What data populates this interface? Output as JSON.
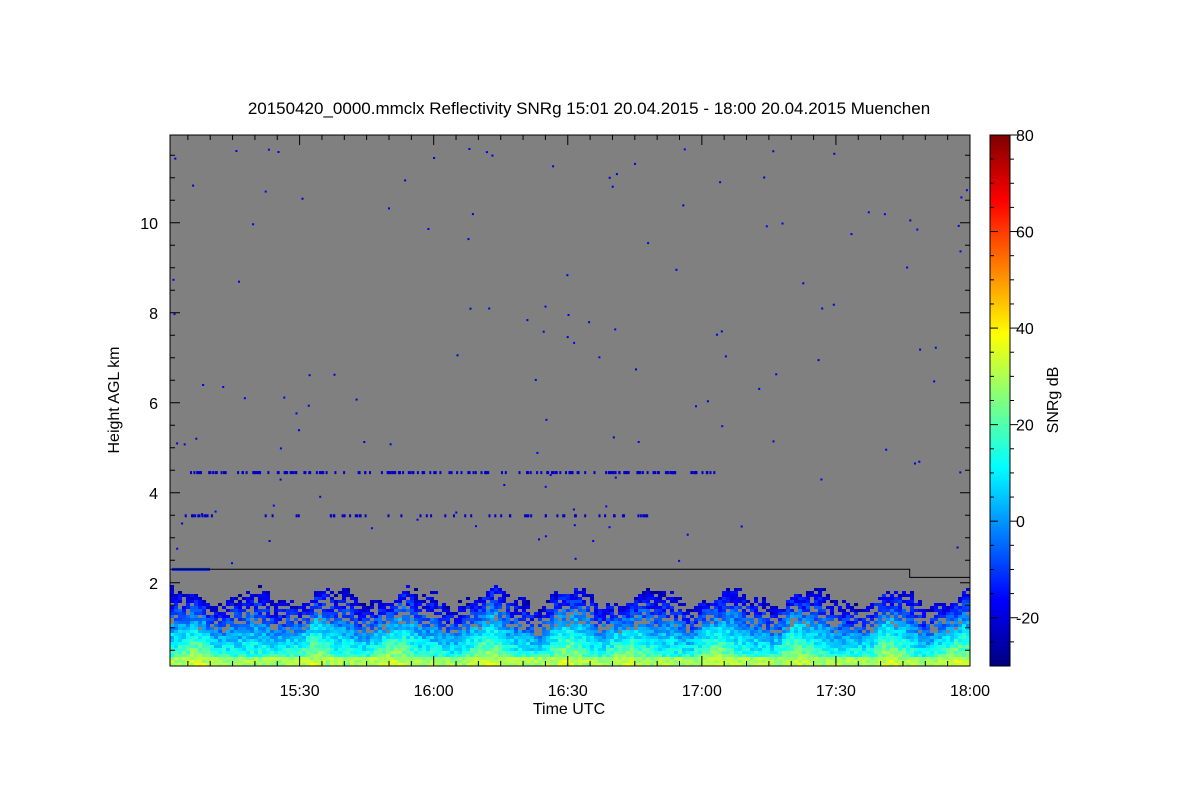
{
  "chart_data": {
    "type": "heatmap",
    "title": "20150420_0000.mmclx Reflectivity SNRg   15:01 20.04.2015 - 18:00 20.04.2015 Muenchen",
    "xlabel": "Time UTC",
    "ylabel": "Height AGL km",
    "colorbar_label": "SNRg dB",
    "x_ticks": [
      "15:30",
      "16:00",
      "16:30",
      "17:00",
      "17:30",
      "18:00"
    ],
    "x_tick_hours": [
      15.5,
      16.0,
      16.5,
      17.0,
      17.5,
      18.0
    ],
    "x_range_hours": [
      15.0167,
      18.0
    ],
    "y_ticks": [
      2,
      4,
      6,
      8,
      10
    ],
    "y_range_km": [
      0.15,
      11.95
    ],
    "colorbar_ticks": [
      -20,
      0,
      20,
      40,
      60,
      80
    ],
    "colorbar_range_db": [
      -30,
      80
    ],
    "colormap": [
      "#00007f",
      "#0000ff",
      "#007fff",
      "#00ffff",
      "#7fff7f",
      "#ffff00",
      "#ff7f00",
      "#ff0000",
      "#7f0000"
    ],
    "background_color": "#808080",
    "boundary_layer_line_km": [
      {
        "from_hour": 15.0167,
        "to_hour": 17.775,
        "height": 2.3
      },
      {
        "from_hour": 17.775,
        "to_hour": 18.0,
        "height": 2.12
      }
    ],
    "noise_bands_km": [
      4.48,
      3.52
    ],
    "low_layer_top_km": 1.8
  }
}
